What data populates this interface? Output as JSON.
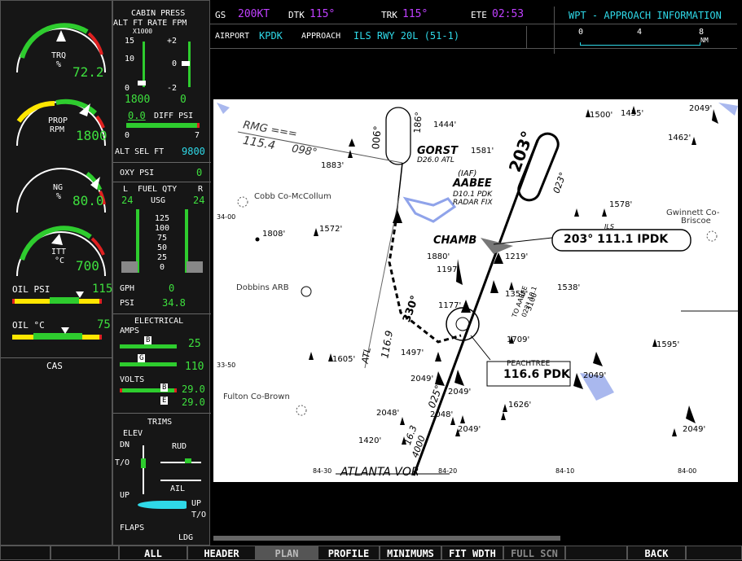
{
  "header": {
    "gs_label": "GS",
    "gs_value": "200KT",
    "dtk_label": "DTK",
    "dtk_value": "115°",
    "trk_label": "TRK",
    "trk_value": "115°",
    "ete_label": "ETE",
    "ete_value": "02:53",
    "page_title": "WPT - APPROACH INFORMATION",
    "airport_label": "AIRPORT",
    "airport_value": "KPDK",
    "approach_label": "APPROACH",
    "approach_value": "ILS RWY 20L (51-1)",
    "scale": {
      "s0": "0",
      "s4": "4",
      "s8": "8",
      "unit": "NM"
    }
  },
  "eis": {
    "trq": {
      "label1": "TRQ",
      "label2": "%",
      "value": "72.2"
    },
    "prop": {
      "label1": "PROP",
      "label2": "RPM",
      "value": "1800"
    },
    "ng": {
      "label1": "NG",
      "label2": "%",
      "value": "80.0"
    },
    "itt": {
      "label1": "ITT",
      "label2": "°C",
      "value": "700"
    },
    "oil_psi": {
      "label": "OIL PSI",
      "value": "115"
    },
    "oil_c": {
      "label": "OIL °C",
      "value": "75"
    },
    "cas": "CAS",
    "cabin": {
      "title": "CABIN PRESS",
      "sub": "ALT FT RATE FPM",
      "x1000": "X1000",
      "t15": "15",
      "tp2": "+2",
      "t10": "10",
      "t0a": "0",
      "t0b": "0",
      "tm2": "-2",
      "alt_value": "1800",
      "rate_value": "0",
      "diff_value": "0.0",
      "diff_label": "DIFF PSI",
      "d0": "0",
      "d7": "7",
      "alt_sel_label": "ALT SEL FT",
      "alt_sel_value": "9800"
    },
    "oxy": {
      "label": "OXY PSI",
      "value": "0"
    },
    "fuel": {
      "l": "L",
      "title": "FUEL QTY",
      "r": "R",
      "unit": "USG",
      "left": "24",
      "right": "24",
      "ticks": [
        "125",
        "100",
        "75",
        "50",
        "25",
        "0"
      ],
      "gph_label": "GPH",
      "gph_value": "0",
      "psi_label": "PSI",
      "psi_value": "34.8"
    },
    "electrical": {
      "title": "ELECTRICAL",
      "amps": "AMPS",
      "amps_b": "25",
      "amps_g": "110",
      "b": "B",
      "g": "G",
      "e": "E",
      "volts": "VOLTS",
      "volts_b": "29.0",
      "volts_e": "29.0"
    },
    "trims": {
      "title": "TRIMS",
      "elev": "ELEV",
      "dn": "DN",
      "to": "T/O",
      "up": "UP",
      "rud": "RUD",
      "ail": "AIL",
      "up2": "UP",
      "to2": "T/O",
      "flaps": "FLAPS",
      "ldg": "LDG"
    }
  },
  "chart": {
    "rmg_freq": "RMG ===",
    "rmg_val": "115.4",
    "rmg_crs": "098°",
    "elev_1883": "1883'",
    "gorst": "GORST",
    "gorst_sub": "D26.0 ATL",
    "elev_1581": "1581'",
    "iaf": "(IAF)",
    "aabee": "AABEE",
    "aabee_s1": "D10.1 PDK",
    "aabee_s2": "RADAR FIX",
    "crs_203": "203°",
    "crs_023": "023°",
    "crs_186": "186°",
    "crs_006": "006°",
    "elev_1444": "1444'",
    "elev_1500": "1500'",
    "elev_1435": "1435'",
    "elev_2049a": "2049'",
    "elev_1462": "1462'",
    "cobb": "Cobb Co-McCollum",
    "lat_3400": "34-00",
    "elev_1808": "1808'",
    "elev_1572": "1572'",
    "elev_1578": "1578'",
    "gwinnett1": "Gwinnett Co-",
    "gwinnett2": "Briscoe",
    "chamb": "CHAMB",
    "ils_label": "ILS",
    "ils_box": "203° 111.1 IPDK",
    "elev_1880": "1880'",
    "elev_1219": "1219'",
    "elev_1197": "1197'",
    "dobbins": "Dobbins ARB",
    "elev_1355": "1355'",
    "elev_1538": "1538'",
    "elev_1177": "1177'",
    "atl": "ATL",
    "atl_val": "116.9",
    "crs_330": "330°",
    "aabee_rot1": "TO AABEE",
    "aabee_rot2": "022° 10.1",
    "aabee_rot3": "3100",
    "elev_1497": "1497'",
    "elev_1709": "1709'",
    "elev_1605": "1605'",
    "lat_3350": "33-50",
    "peachtree": "PEACHTREE",
    "peach_freq": "116.6 PDK",
    "elev_1595": "1595'",
    "elev_2049b": "2049'",
    "elev_2049c": "2049'",
    "elev_2049d": "2049'",
    "fulton": "Fulton Co-Brown",
    "elev_1626": "1626'",
    "elev_2048": "2048'",
    "elev_2048b": "2048'",
    "elev_2049e": "2049'",
    "elev_2049f": "2049'",
    "elev_1420": "1420'",
    "crs_025": "025°",
    "crs_163": "16.3",
    "alt_4000": "4000",
    "lon_8430": "84-30",
    "atlanta_vor": "ATLANTA VOR",
    "lon_8420": "84-20",
    "lon_8410": "84-10",
    "lon_8400": "84-00"
  },
  "softkeys": [
    "ALL",
    "HEADER",
    "PLAN",
    "PROFILE",
    "MINIMUMS",
    "FIT WDTH",
    "FULL SCN",
    "BACK"
  ],
  "colors": {
    "cyan": "#2fd9e8",
    "magenta": "#c040ff",
    "green": "#3ee03e",
    "yellow": "#ffe600",
    "red": "#e02020"
  }
}
